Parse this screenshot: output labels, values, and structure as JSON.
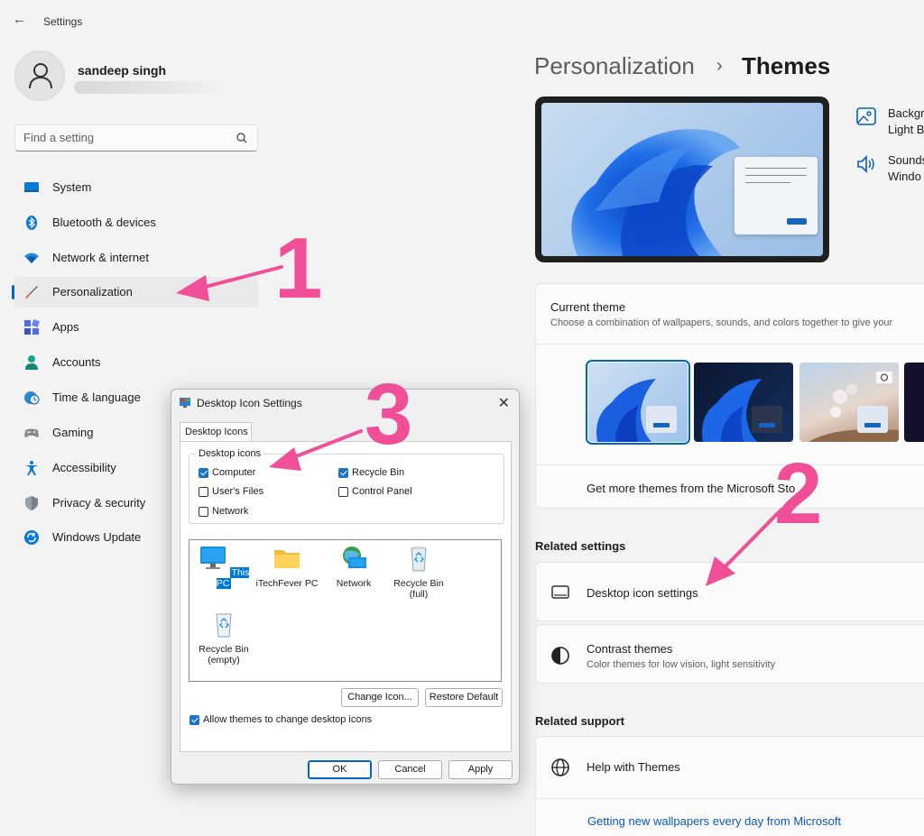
{
  "window": {
    "title": "Settings",
    "back_icon": "arrow-left-icon"
  },
  "profile": {
    "name": "sandeep singh"
  },
  "search": {
    "placeholder": "Find a setting"
  },
  "sidebar": {
    "items": [
      {
        "label": "System",
        "icon": "monitor-icon",
        "color": "#0078d4"
      },
      {
        "label": "Bluetooth & devices",
        "icon": "bluetooth-icon",
        "color": "#0078d4"
      },
      {
        "label": "Network & internet",
        "icon": "wifi-icon",
        "color": "#0078d4"
      },
      {
        "label": "Personalization",
        "icon": "brush-icon",
        "color": "#e8663d",
        "active": true
      },
      {
        "label": "Apps",
        "icon": "apps-icon",
        "color": "#4f6bed"
      },
      {
        "label": "Accounts",
        "icon": "person-icon",
        "color": "#17a589"
      },
      {
        "label": "Time & language",
        "icon": "clock-globe-icon",
        "color": "#0078d4"
      },
      {
        "label": "Gaming",
        "icon": "gamepad-icon",
        "color": "#7a7a7a"
      },
      {
        "label": "Accessibility",
        "icon": "accessibility-icon",
        "color": "#0078d4"
      },
      {
        "label": "Privacy & security",
        "icon": "shield-icon",
        "color": "#6b7280"
      },
      {
        "label": "Windows Update",
        "icon": "sync-icon",
        "color": "#0078d4"
      }
    ]
  },
  "header": {
    "breadcrumb_parent": "Personalization",
    "breadcrumb_separator": "›",
    "breadcrumb_current": "Themes"
  },
  "theme_side_options": [
    {
      "title": "Backgr",
      "subtitle": "Light B",
      "icon": "image-icon"
    },
    {
      "title": "Sounds",
      "subtitle": "Windo",
      "icon": "speaker-icon"
    }
  ],
  "current_theme": {
    "title": "Current theme",
    "subtitle": "Choose a combination of wallpapers, sounds, and colors together to give your",
    "get_more": "Get more themes from the Microsoft Sto"
  },
  "related_settings": {
    "heading": "Related settings",
    "items": [
      {
        "title": "Desktop icon settings",
        "icon": "desktop-icon"
      },
      {
        "title": "Contrast themes",
        "subtitle": "Color themes for low vision, light sensitivity",
        "icon": "contrast-icon"
      }
    ]
  },
  "related_support": {
    "heading": "Related support",
    "item": {
      "title": "Help with Themes",
      "icon": "globe-icon"
    },
    "link": "Getting new wallpapers every day from Microsoft"
  },
  "dialog": {
    "title": "Desktop Icon Settings",
    "close": "✕",
    "tab": "Desktop Icons",
    "group_label": "Desktop icons",
    "checkboxes": [
      {
        "label": "Computer",
        "checked": true
      },
      {
        "label": "Recycle Bin",
        "checked": true
      },
      {
        "label": "User's Files",
        "checked": false
      },
      {
        "label": "Control Panel",
        "checked": false
      },
      {
        "label": "Network",
        "checked": false
      }
    ],
    "icons": [
      {
        "label": "This PC",
        "icon": "this-pc-icon",
        "selected": true
      },
      {
        "label": "iTechFever PC",
        "icon": "folder-icon",
        "selected": false
      },
      {
        "label": "Network",
        "icon": "network-icon",
        "selected": false
      },
      {
        "label": "Recycle Bin (full)",
        "line1": "Recycle Bin",
        "line2": "(full)",
        "icon": "recycle-bin-full-icon",
        "selected": false
      },
      {
        "label": "Recycle Bin (empty)",
        "line1": "Recycle Bin",
        "line2": "(empty)",
        "icon": "recycle-bin-empty-icon",
        "selected": false
      }
    ],
    "change_icon": "Change Icon...",
    "restore_default": "Restore Default",
    "allow_themes": {
      "label": "Allow themes to change desktop icons",
      "checked": true
    },
    "ok": "OK",
    "cancel": "Cancel",
    "apply": "Apply"
  },
  "annotations": {
    "step1": "1",
    "step2": "2",
    "step3": "3",
    "color": "#f04f97"
  }
}
